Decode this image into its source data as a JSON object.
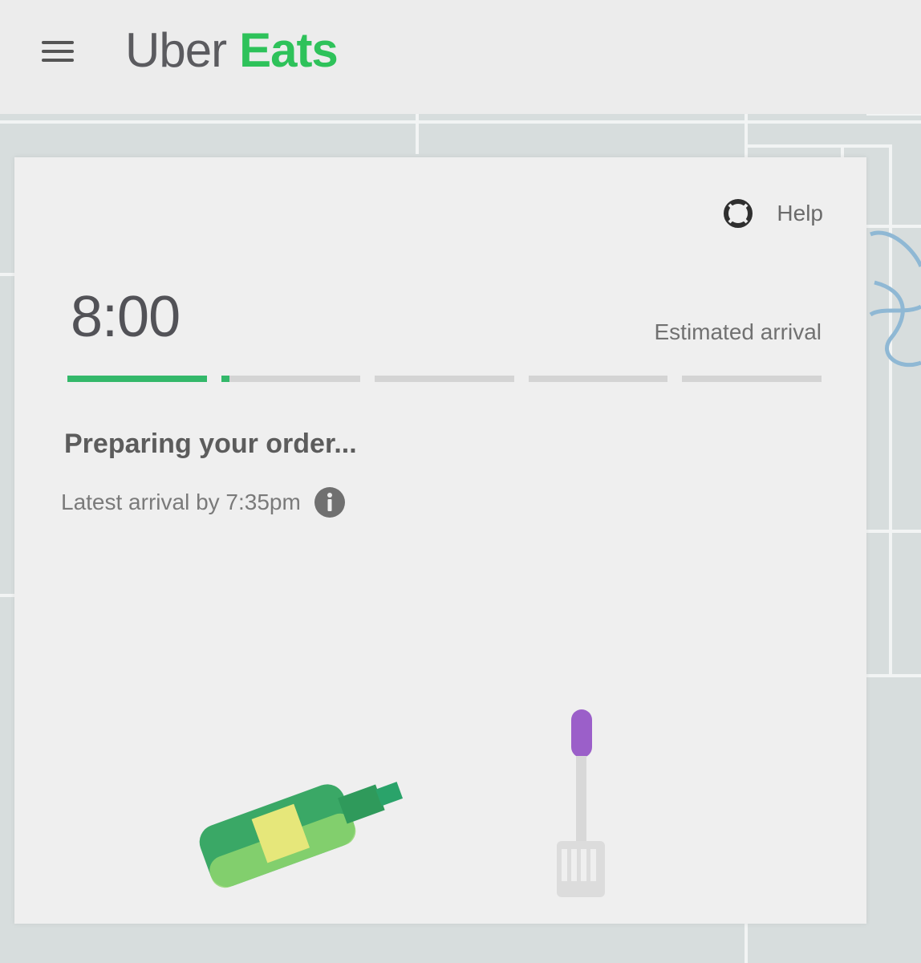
{
  "header": {
    "menu_icon": "hamburger-menu-icon",
    "logo_part1": "Uber",
    "logo_part2": "Eats",
    "logo_color_dark": "#5b5b5f",
    "logo_color_green": "#2ec25a"
  },
  "tracker": {
    "help_label": "Help",
    "help_icon": "lifebuoy-icon",
    "eta_time": "8:00",
    "eta_label": "Estimated arrival",
    "progress_steps": [
      1.0,
      0.06,
      0,
      0,
      0
    ],
    "progress_color": "#33b86a",
    "status_text": "Preparing your order...",
    "latest_arrival": "Latest arrival by 7:35pm",
    "info_icon": "info-icon",
    "illustration_icons": [
      "oil-bottle-icon",
      "spatula-icon"
    ]
  }
}
